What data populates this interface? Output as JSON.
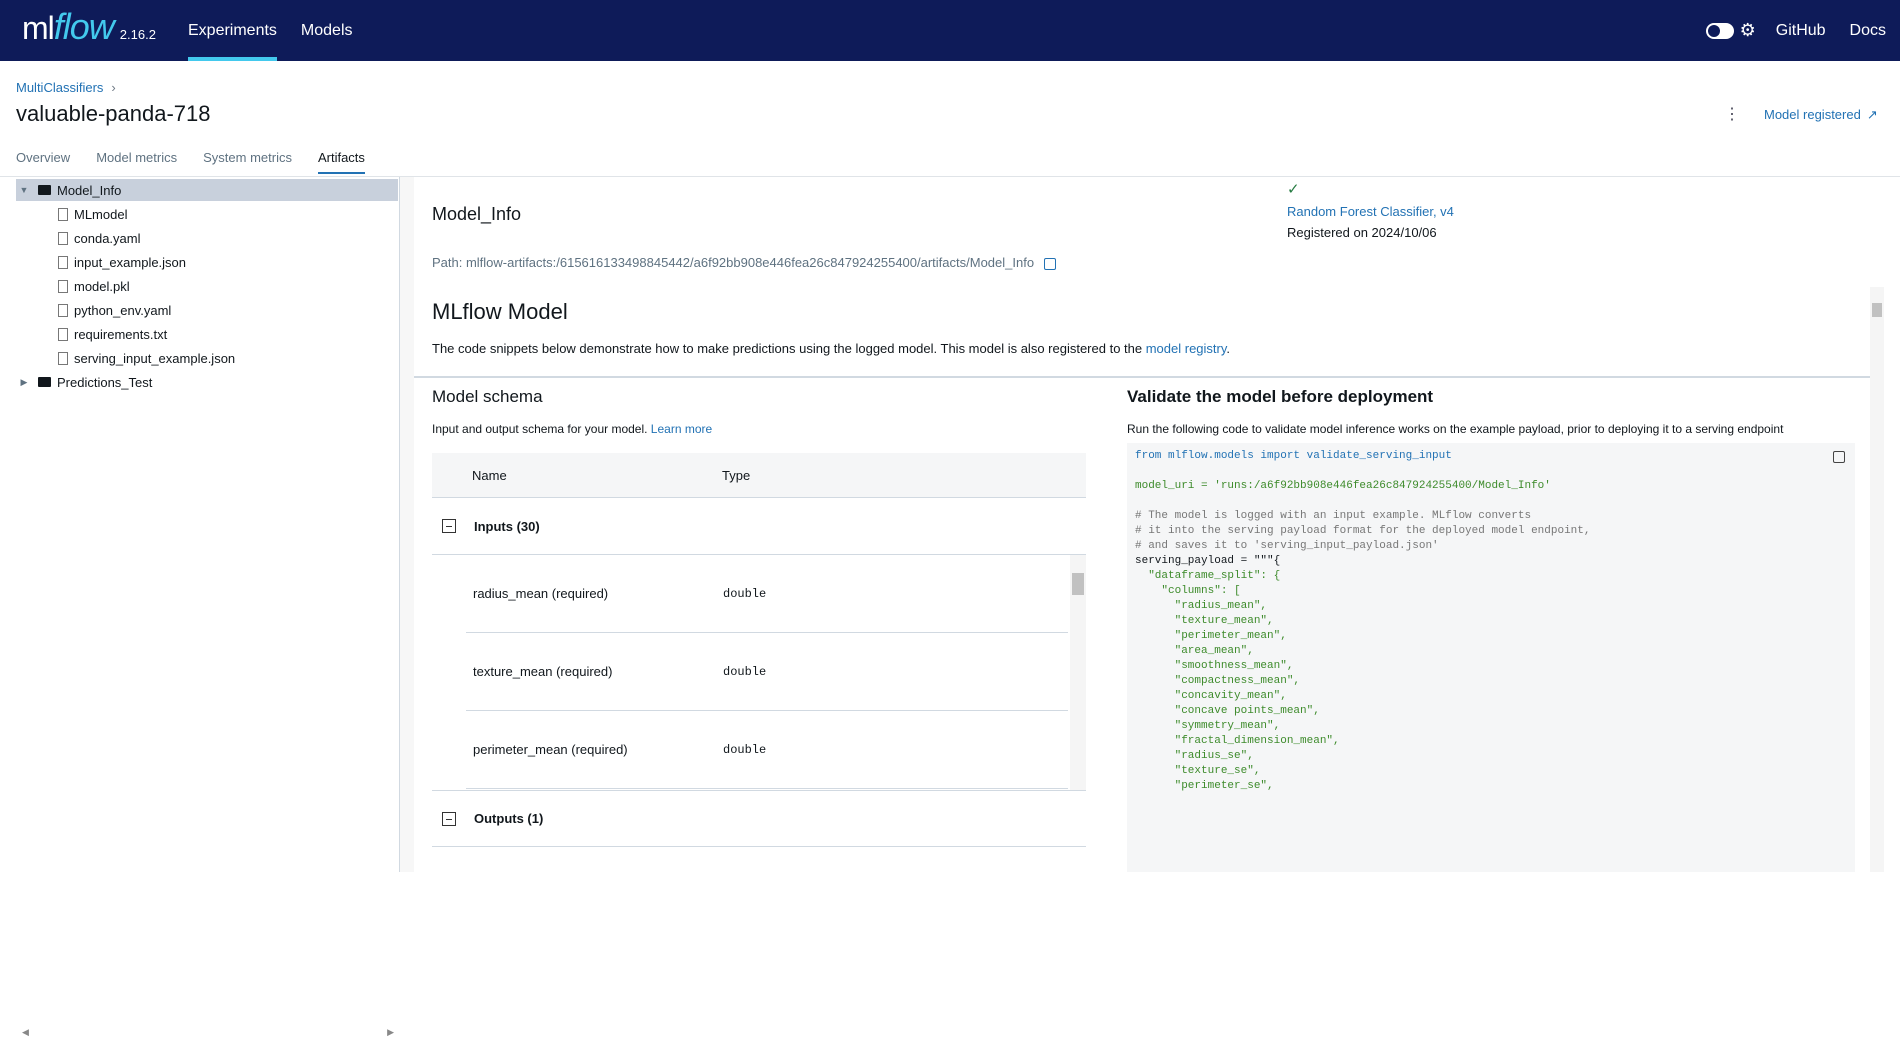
{
  "topbar": {
    "logo_ml": "ml",
    "logo_flow": "flow",
    "version": "2.16.2",
    "nav": [
      "Experiments",
      "Models"
    ],
    "github": "GitHub",
    "docs": "Docs"
  },
  "breadcrumb": {
    "parent": "MultiClassifiers",
    "sep": "›"
  },
  "run_title": "valuable-panda-718",
  "model_registered": "Model registered",
  "tabs": [
    "Overview",
    "Model metrics",
    "System metrics",
    "Artifacts"
  ],
  "tree": {
    "root": "Model_Info",
    "files": [
      "MLmodel",
      "conda.yaml",
      "input_example.json",
      "model.pkl",
      "python_env.yaml",
      "requirements.txt",
      "serving_input_example.json"
    ],
    "other": "Predictions_Test"
  },
  "artifact": {
    "title": "Model_Info",
    "path": "Path: mlflow-artifacts:/615616133498845442/a6f92bb908e446fea26c847924255400/artifacts/Model_Info"
  },
  "registration": {
    "model": "Random Forest Classifier, v4",
    "date": "Registered on 2024/10/06"
  },
  "mlflow_model": {
    "title": "MLflow Model",
    "desc_pre": "The code snippets below demonstrate how to make predictions using the logged model. This model is also registered to the ",
    "desc_link": "model registry",
    "desc_post": "."
  },
  "schema": {
    "title": "Model schema",
    "desc": "Input and output schema for your model. ",
    "learn": "Learn more",
    "col_name": "Name",
    "col_type": "Type",
    "inputs": "Inputs (30)",
    "outputs": "Outputs (1)",
    "rows": [
      {
        "name": "radius_mean (required)",
        "type": "double"
      },
      {
        "name": "texture_mean (required)",
        "type": "double"
      },
      {
        "name": "perimeter_mean (required)",
        "type": "double"
      }
    ]
  },
  "validate": {
    "title": "Validate the model before deployment",
    "desc": "Run the following code to validate model inference works on the example payload, prior to deploying it to a serving endpoint",
    "code": [
      {
        "t": "from mlflow.models import validate_serving_input",
        "c": "kw"
      },
      {
        "t": "",
        "c": ""
      },
      {
        "t": "model_uri = 'runs:/a6f92bb908e446fea26c847924255400/Model_Info'",
        "c": "str"
      },
      {
        "t": "",
        "c": ""
      },
      {
        "t": "# The model is logged with an input example. MLflow converts",
        "c": "cm"
      },
      {
        "t": "# it into the serving payload format for the deployed model endpoint,",
        "c": "cm"
      },
      {
        "t": "# and saves it to 'serving_input_payload.json'",
        "c": "cm"
      },
      {
        "t": "serving_payload = \"\"\"{",
        "c": ""
      },
      {
        "t": "  \"dataframe_split\": {",
        "c": "str"
      },
      {
        "t": "    \"columns\": [",
        "c": "str"
      },
      {
        "t": "      \"radius_mean\",",
        "c": "str"
      },
      {
        "t": "      \"texture_mean\",",
        "c": "str"
      },
      {
        "t": "      \"perimeter_mean\",",
        "c": "str"
      },
      {
        "t": "      \"area_mean\",",
        "c": "str"
      },
      {
        "t": "      \"smoothness_mean\",",
        "c": "str"
      },
      {
        "t": "      \"compactness_mean\",",
        "c": "str"
      },
      {
        "t": "      \"concavity_mean\",",
        "c": "str"
      },
      {
        "t": "      \"concave points_mean\",",
        "c": "str"
      },
      {
        "t": "      \"symmetry_mean\",",
        "c": "str"
      },
      {
        "t": "      \"fractal_dimension_mean\",",
        "c": "str"
      },
      {
        "t": "      \"radius_se\",",
        "c": "str"
      },
      {
        "t": "      \"texture_se\",",
        "c": "str"
      },
      {
        "t": "      \"perimeter_se\",",
        "c": "str"
      }
    ]
  }
}
